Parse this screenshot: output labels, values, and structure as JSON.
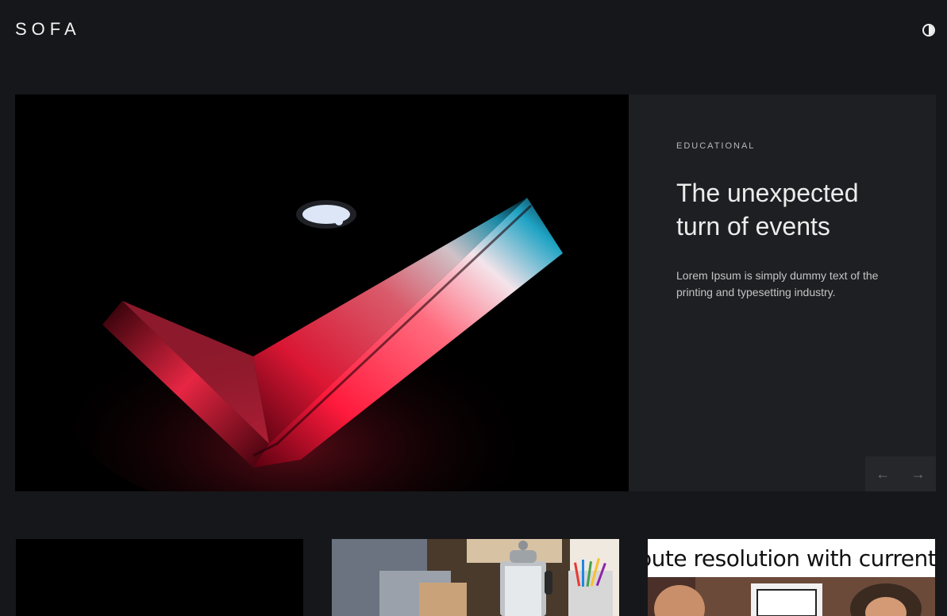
{
  "header": {
    "logo": "SOFA",
    "theme_toggle_icon": "contrast-icon"
  },
  "hero": {
    "image_alt_icon": "laptop-image",
    "category": "EDUCATIONAL",
    "title": "The unexpected turn of events",
    "excerpt": "Lorem Ipsum is simply dummy text of the printing and typesetting industry.",
    "prev_icon": "arrow-left-icon",
    "next_icon": "arrow-right-icon",
    "prev_glyph": "←",
    "next_glyph": "→"
  },
  "cards": [
    {
      "image": "black-image"
    },
    {
      "image": "coffee-desk-image"
    },
    {
      "image": "meme-image",
      "caption": "oute resolution with current sy"
    }
  ],
  "colors": {
    "background": "#16171a",
    "panel": "#1e1f23",
    "nav_box": "#26272b",
    "accent_red": "#ff1a3c",
    "accent_cyan": "#1fa3c4"
  }
}
